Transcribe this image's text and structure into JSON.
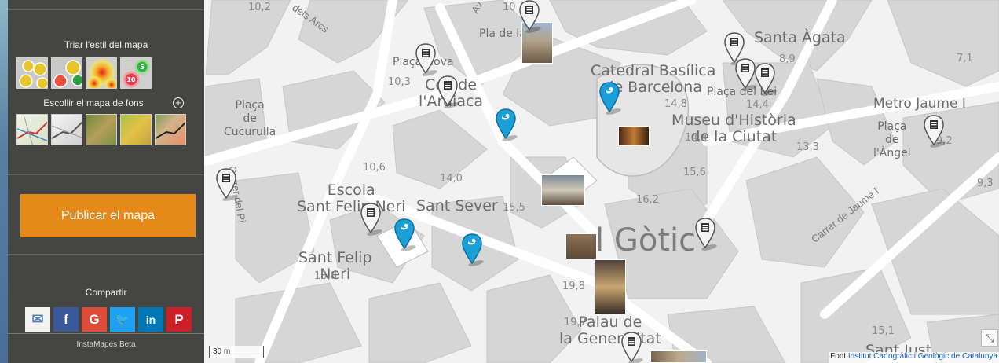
{
  "sidebar": {
    "style_title": "Triar l'estil del mapa",
    "basemap_title": "Escollir el mapa de fons",
    "basemap_add_icon": "plus-circle-icon",
    "style_thumbs": [
      "points",
      "dots",
      "heatmap",
      "clusters"
    ],
    "basemap_thumbs": [
      "topographic",
      "grayscale",
      "relief",
      "orthophoto",
      "hybrid"
    ],
    "cluster_badges": [
      "5",
      "10"
    ],
    "publish_label": "Publicar el mapa",
    "share_title": "Compartir",
    "share_buttons": [
      {
        "name": "email",
        "icon": "envelope-icon",
        "glyph": "✉",
        "color": "#f4f4f4"
      },
      {
        "name": "facebook",
        "icon": "facebook-icon",
        "glyph": "f",
        "color": "#3b5998"
      },
      {
        "name": "google",
        "icon": "google-plus-icon",
        "glyph": "G",
        "color": "#dd4b39"
      },
      {
        "name": "twitter",
        "icon": "twitter-icon",
        "glyph": "🐦",
        "color": "#1da1f2"
      },
      {
        "name": "linkedin",
        "icon": "linkedin-icon",
        "glyph": "in",
        "color": "#0077b5"
      },
      {
        "name": "pinterest",
        "icon": "pinterest-icon",
        "glyph": "P",
        "color": "#cb2027"
      }
    ],
    "footer": "InstaMapes Beta"
  },
  "map": {
    "labels": {
      "catedral": "Catedral Basílica\nde Barcelona",
      "santa_agata": "Santa Àgata",
      "museu": "Museu d'Història\nde la Ciutat",
      "metro": "Metro Jaume I",
      "placa_angel": "Plaça\nde\nl'Àngel",
      "placa_rei": "Plaça del Rei",
      "placa_nova": "Plaça Nova",
      "pla_seu": "Pla de la",
      "col_arquitectes": "Col. de\nl'Ardiaca",
      "placa_cucurulla": "Plaça\nde\nCucurulla",
      "escola_neri": "Escola\nSant Felip Neri",
      "sant_sever": "Sant Sever",
      "sant_felip": "Sant Felip\nNeri",
      "gotic": "l Gòtic",
      "palau": "Palau de\nla Generalitat",
      "sant_just": "Sant Just",
      "carrer_jaume": "Carrer de Jaume I",
      "carrer_arcs": "dels Arcs",
      "carrer_pi": "Carrer del Pi",
      "avinguda": "Av"
    },
    "elevations": [
      "10,2",
      "10,3",
      "10",
      "8,9",
      "7,1",
      "14,8",
      "14,4",
      "14,4",
      "13,3",
      "15,6",
      "9,2",
      "9,3",
      "10,6",
      "14,0",
      "15,5",
      "16,2",
      "13,8",
      "19,8",
      "19,7",
      "15,1"
    ],
    "markers": [
      {
        "type": "book",
        "icon": "book-marker-icon"
      },
      {
        "type": "twitter",
        "icon": "twitter-marker-icon"
      }
    ],
    "scale": "30 m",
    "attribution_prefix": "Font:",
    "attribution_link": "Institut Cartogràfic i Geològic de Catalunya",
    "expand_icon": "expand-icon"
  }
}
